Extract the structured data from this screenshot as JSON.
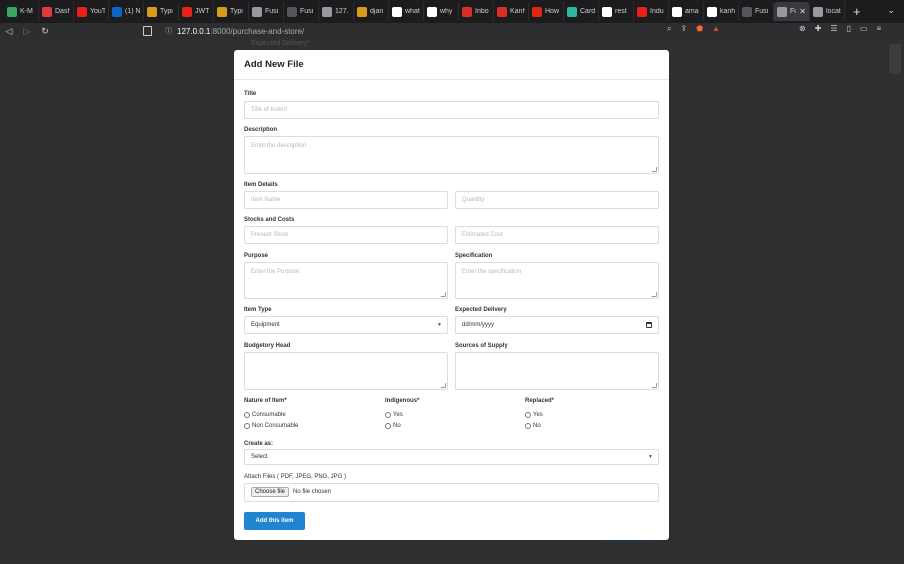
{
  "browser": {
    "tabs": [
      {
        "title": "K-M",
        "color": "#3aa55b"
      },
      {
        "title": "Dash",
        "color": "#e03b3b"
      },
      {
        "title": "YouT",
        "color": "#e62117"
      },
      {
        "title": "(1) N",
        "color": "#0a66c2"
      },
      {
        "title": "Typi",
        "color": "#d79b1e"
      },
      {
        "title": "JWT",
        "color": "#e62117"
      },
      {
        "title": "Typi",
        "color": "#d79b1e"
      },
      {
        "title": "Fusi",
        "color": "#9a9a9e"
      },
      {
        "title": "Fusi",
        "color": "#555559"
      },
      {
        "title": "127.",
        "color": "#9a9a9e"
      },
      {
        "title": "djan",
        "color": "#d79b1e"
      },
      {
        "title": "what",
        "color": "#ffffff"
      },
      {
        "title": "why",
        "color": "#ffffff"
      },
      {
        "title": "Inbo",
        "color": "#d93025"
      },
      {
        "title": "Kanh",
        "color": "#d93025"
      },
      {
        "title": "How",
        "color": "#e62117"
      },
      {
        "title": "Card",
        "color": "#2ab6a1"
      },
      {
        "title": "rest",
        "color": "#ffffff"
      },
      {
        "title": "Indu",
        "color": "#e62117"
      },
      {
        "title": "ama",
        "color": "#ffffff"
      },
      {
        "title": "kanh",
        "color": "#ffffff"
      },
      {
        "title": "Fusi",
        "color": "#555559"
      },
      {
        "title": "Fu",
        "color": "#9a9a9e"
      },
      {
        "title": "locat",
        "color": "#9a9a9e"
      }
    ],
    "active_tab_close": "✕",
    "new_tab": "+",
    "url_host": "127.0.0.1",
    "url_path": ":8000/purchase-and-store/"
  },
  "background": {
    "label": "Expected Delivery*"
  },
  "modal": {
    "title": "Add New File",
    "title_label": "Title",
    "title_placeholder": "Title of Indent",
    "description_label": "Description",
    "description_placeholder": "Enter the description",
    "item_details_label": "Item Details",
    "item_name_placeholder": "Item Name",
    "quantity_placeholder": "Quantity",
    "stocks_label": "Stocks and Costs",
    "present_stock_placeholder": "Present Stock",
    "estimated_cost_placeholder": "Estimated Cost",
    "purpose_label": "Purpose",
    "purpose_placeholder": "Enter the Purpose",
    "specification_label": "Specification",
    "specification_placeholder": "Enter the specification",
    "item_type_label": "Item Type",
    "item_type_value": "Equipment",
    "expected_delivery_label": "Expected Delivery",
    "expected_delivery_value": "dd/mm/yyyy",
    "budgetory_head_label": "Budgetory Head",
    "sources_label": "Sources of Supply",
    "nature_label": "Nature of Item*",
    "nature_options": [
      "Consumable",
      "Non Consumable"
    ],
    "indigenous_label": "Indigenous*",
    "indigenous_options": [
      "Yes",
      "No"
    ],
    "replaced_label": "Replaced*",
    "replaced_options": [
      "Yes",
      "No"
    ],
    "create_as_label": "Create as:",
    "create_as_value": "Select",
    "attach_label": "Attach Files ( PDF, JPEG, PNG, JPG )",
    "choose_file": "Choose file",
    "no_file": "No file chosen",
    "submit": "Add this item"
  }
}
